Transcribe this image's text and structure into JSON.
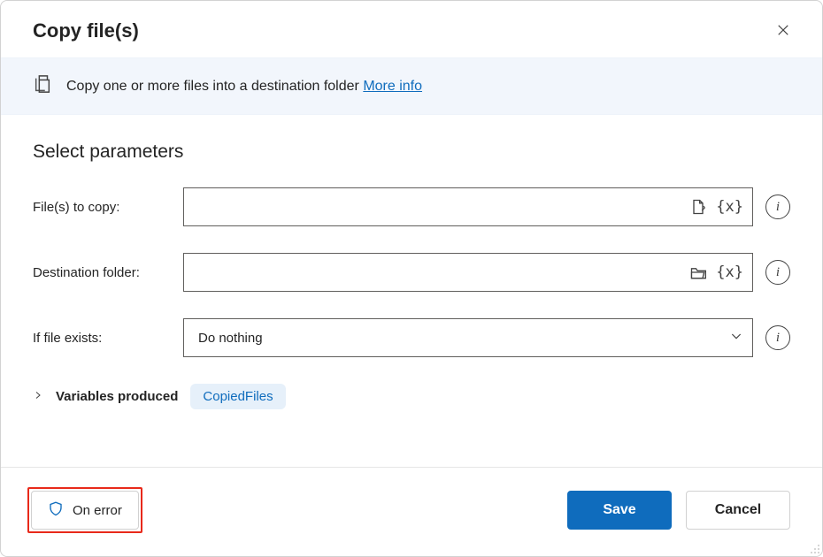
{
  "header": {
    "title": "Copy file(s)"
  },
  "banner": {
    "text": "Copy one or more files into a destination folder",
    "more_info": "More info"
  },
  "section": {
    "title": "Select parameters"
  },
  "fields": {
    "files_to_copy": {
      "label": "File(s) to copy:",
      "value": ""
    },
    "destination_folder": {
      "label": "Destination folder:",
      "value": ""
    },
    "if_file_exists": {
      "label": "If file exists:",
      "selected": "Do nothing"
    }
  },
  "variables": {
    "label": "Variables produced",
    "chip": "CopiedFiles"
  },
  "footer": {
    "on_error": "On error",
    "save": "Save",
    "cancel": "Cancel"
  }
}
